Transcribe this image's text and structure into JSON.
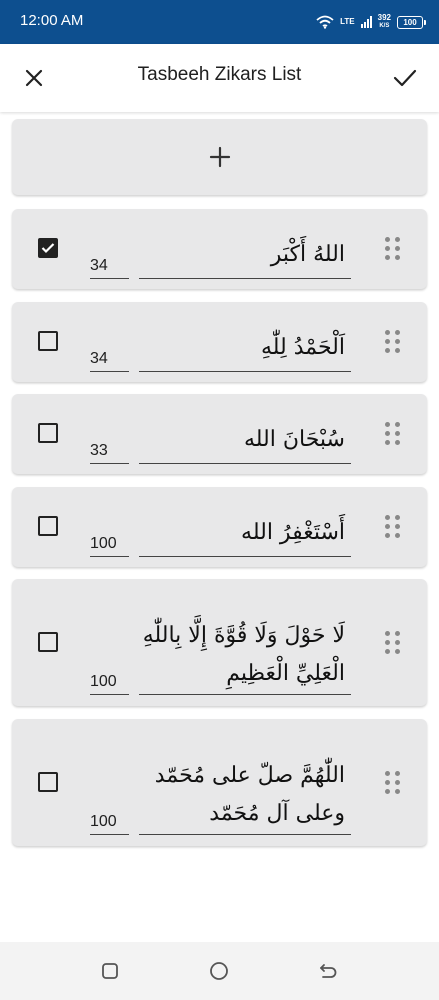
{
  "status_bar": {
    "time": "12:00 AM",
    "network_type": "LTE",
    "speed_value": "392",
    "speed_unit": "K/S",
    "battery": "100"
  },
  "app_bar": {
    "title": "Tasbeeh Zikars List",
    "close_icon": "close-icon",
    "confirm_icon": "check-icon"
  },
  "add_button": {
    "icon": "plus-icon"
  },
  "zikars": [
    {
      "checked": true,
      "count": "34",
      "lines": [
        "اللهُ أَكْبَر"
      ]
    },
    {
      "checked": false,
      "count": "34",
      "lines": [
        "اَلْحَمْدُ لِلّٰهِ"
      ]
    },
    {
      "checked": false,
      "count": "33",
      "lines": [
        "سُبْحَانَ الله"
      ]
    },
    {
      "checked": false,
      "count": "100",
      "lines": [
        "أَسْتَغْفِرُ الله"
      ]
    },
    {
      "checked": false,
      "count": "100",
      "lines": [
        "لَا حَوْلَ وَلَا قُوَّةَ إِلَّا بِاللّٰهِ",
        "الْعَلِيِّ الْعَظِيمِ"
      ]
    },
    {
      "checked": false,
      "count": "100",
      "lines": [
        "اللّٰهُمَّ صلّ على مُحَمّد",
        "وعلى آل مُحَمّد"
      ]
    }
  ],
  "nav_bar": {
    "recents_icon": "recents-icon",
    "home_icon": "home-icon",
    "back_icon": "back-icon"
  },
  "colors": {
    "status_bar": "#0d4f8f",
    "card_background": "#e8e8e9",
    "text": "#202020",
    "drag_dots": "#888888"
  }
}
